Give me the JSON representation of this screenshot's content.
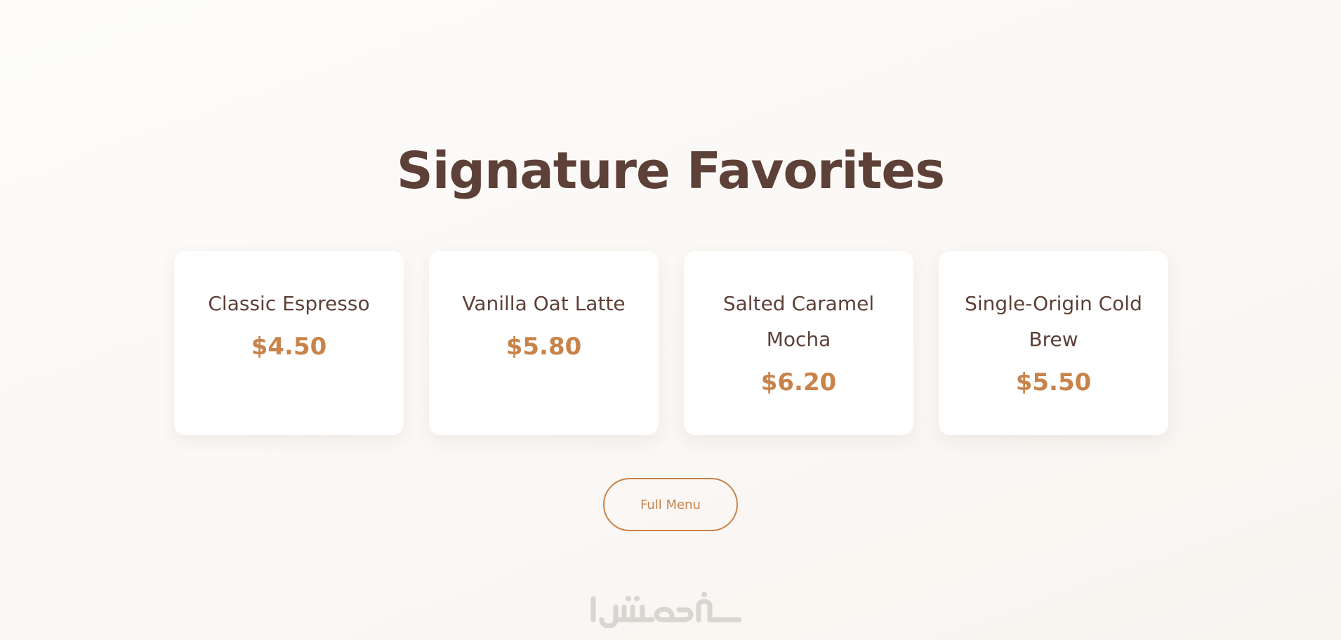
{
  "section": {
    "title": "Signature Favorites"
  },
  "menu_items": [
    {
      "name": "Classic Espresso",
      "price": "$4.50"
    },
    {
      "name": "Vanilla Oat Latte",
      "price": "$5.80"
    },
    {
      "name": "Salted Caramel Mocha",
      "price": "$6.20"
    },
    {
      "name": "Single-Origin Cold Brew",
      "price": "$5.50"
    }
  ],
  "cta": {
    "label": "Full Menu"
  },
  "watermark": {
    "text": "خمسات"
  },
  "colors": {
    "heading": "#5d4037",
    "price_accent": "#c8834a",
    "card_background": "#ffffff",
    "page_background": "#faf7f4",
    "watermark": "#d9d6d2"
  }
}
